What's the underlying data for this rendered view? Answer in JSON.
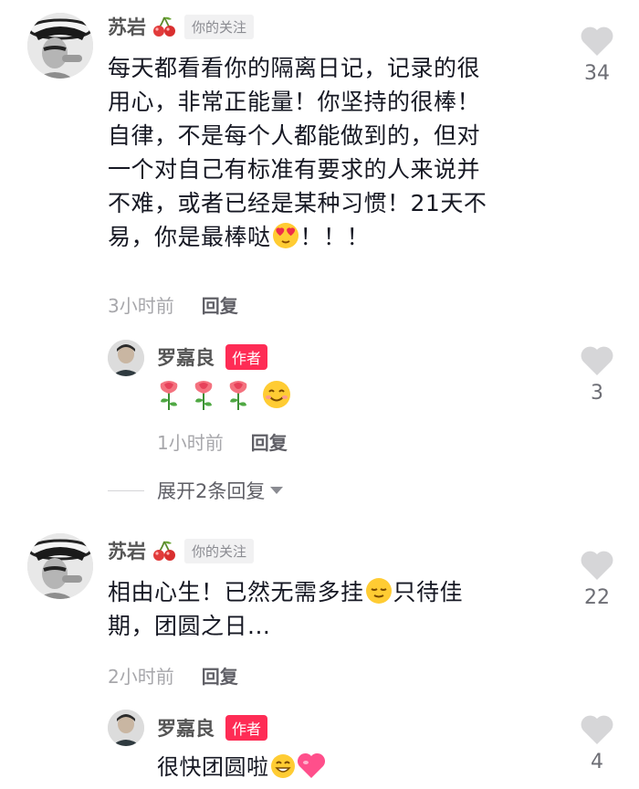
{
  "comments": [
    {
      "username": "苏岩",
      "badge": "你的关注",
      "lines": [
        "每天都看看你的隔离日记，记录的很",
        "用心，非常正能量！你坚持的很棒！",
        "自律，不是每个人都能做到的，但对",
        "一个对自己有标准有要求的人来说并",
        "不难，或者已经是某种习惯！21天不",
        "易，你是最棒哒"
      ],
      "line_tail": "！！！",
      "time": "3小时前",
      "reply_label": "回复",
      "likes": "34",
      "replies": [
        {
          "username": "罗嘉良",
          "badge": "作者",
          "time": "1小时前",
          "reply_label": "回复",
          "likes": "3"
        }
      ],
      "expand_label": "展开2条回复"
    },
    {
      "username": "苏岩",
      "badge": "你的关注",
      "lines": [
        "相由心生！已然无需多挂",
        "期，团圆之日..."
      ],
      "line1_tail": "只待佳",
      "time": "2小时前",
      "reply_label": "回复",
      "likes": "22",
      "replies": [
        {
          "username": "罗嘉良",
          "badge": "作者",
          "text": "很快团圆啦",
          "likes": "4"
        }
      ]
    }
  ],
  "colors": {
    "author_badge": "#fe2c55",
    "like_icon": "#d6d6d8",
    "time_text": "#a7a7ab"
  },
  "icons": [
    "cherry-icon",
    "heart-icon",
    "rose-icon",
    "smile-emoji",
    "heart-eyes-emoji",
    "relieved-emoji",
    "grin-emoji",
    "pink-heart-emoji",
    "caret-down-icon"
  ]
}
